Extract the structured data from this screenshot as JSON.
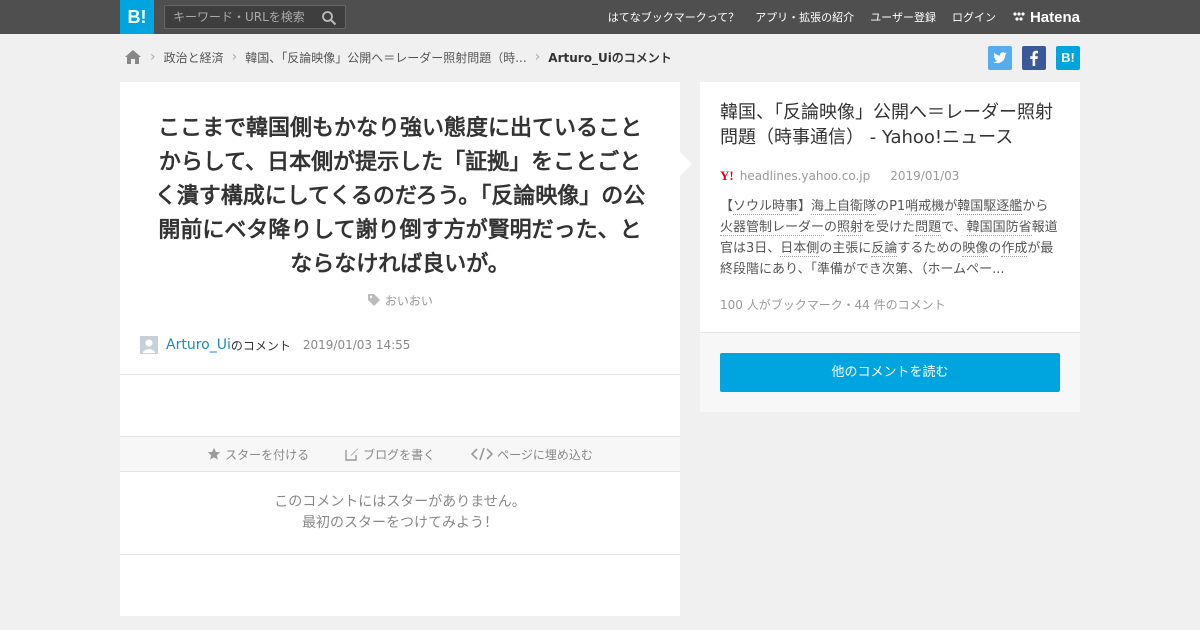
{
  "header": {
    "logo": "B!",
    "search_placeholder": "キーワード・URLを検索",
    "nav": [
      "はてなブックマークって？",
      "アプリ・拡張の紹介",
      "ユーザー登録",
      "ログイン"
    ],
    "brand": "Hatena"
  },
  "breadcrumb": {
    "items": [
      "政治と経済",
      "韓国、「反論映像」公開へ＝レーダー照射問題（時..."
    ],
    "current": "Arturo_Uiのコメント"
  },
  "share": {
    "twitter": "t",
    "facebook": "f",
    "hatena": "B!"
  },
  "comment": {
    "text": "ここまで韓国側もかなり強い態度に出ていることからして、日本側が提示した「証拠」をことごとく潰す構成にしてくるのだろう。「反論映像」の公開前にベタ降りして謝り倒す方が賢明だった、とならなければ良いが。",
    "tag": "おいおい",
    "author": "Arturo_Ui",
    "author_suffix": "のコメント",
    "datetime": "2019/01/03 14:55"
  },
  "actions": {
    "star": "スターを付ける",
    "blog": "ブログを書く",
    "embed": "ページに埋め込む"
  },
  "no_star": {
    "line1": "このコメントにはスターがありません。",
    "line2": "最初のスターをつけてみよう！"
  },
  "entry": {
    "title": "韓国、「反論映像」公開へ＝レーダー照射問題（時事通信） - Yahoo!ニュース",
    "domain": "headlines.yahoo.co.jp",
    "date": "2019/01/03",
    "summary": {
      "s1": "【",
      "s2": "ソウル時事",
      "s3": "】",
      "s4": "海上自衛隊",
      "s5": "のP1",
      "s6": "哨戒機",
      "s7": "が",
      "s8": "韓国駆逐艦",
      "s9": "から",
      "s10": "火器管制レーダー",
      "s11": "の",
      "s12": "照射",
      "s13": "を受けた",
      "s14": "問題",
      "s15": "で、",
      "s16": "韓国国防省",
      "s17": "報道官は3日、",
      "s18": "日本側",
      "s19": "の主張に",
      "s20": "反論",
      "s21": "するための",
      "s22": "映像",
      "s23": "の",
      "s24": "作成",
      "s25": "が最終段階にあり、「準備ができ次第、（ホームペー..."
    },
    "stats": "100 人がブックマーク・44 件のコメント",
    "read_more": "他のコメントを読む"
  },
  "colors": {
    "accent": "#00a4de",
    "topbar": "#4f4f4f",
    "twitter": "#55acee",
    "facebook": "#3b5998"
  }
}
